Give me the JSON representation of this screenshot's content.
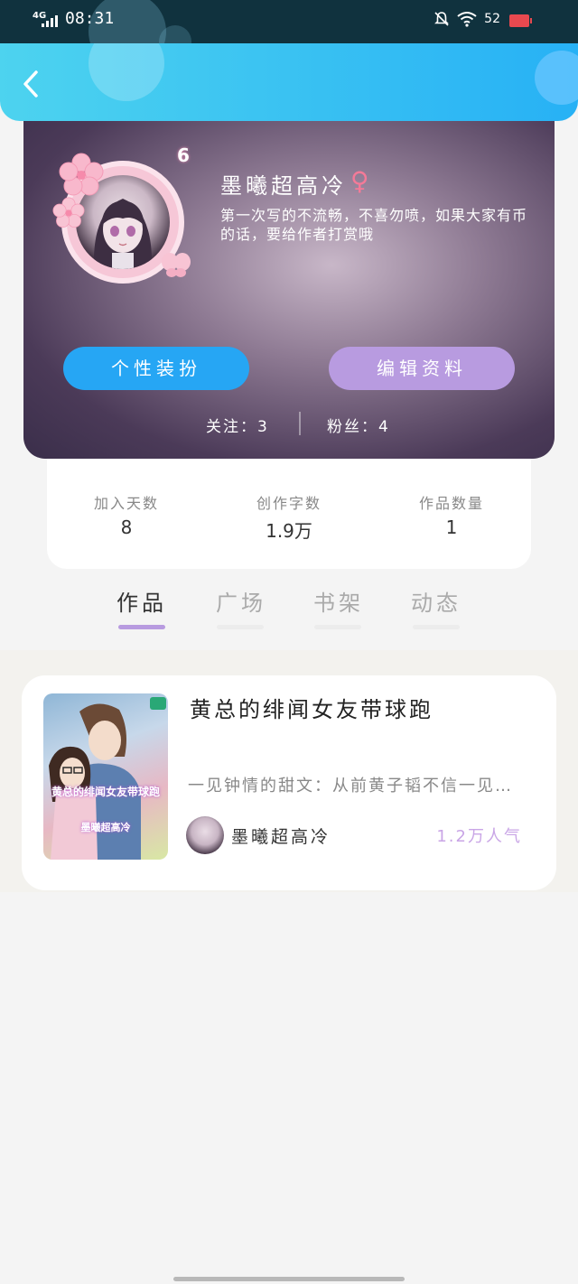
{
  "status_bar": {
    "network": "4G",
    "time": "08:31",
    "battery": "52"
  },
  "header": {
    "back_icon": "chevron-left-icon"
  },
  "profile": {
    "level": "6",
    "username": "墨曦超高冷",
    "gender_symbol": "♀",
    "gender_color": "#f47a98",
    "bio": "第一次写的不流畅，不喜勿喷，如果大家有币的话，要给作者打赏哦",
    "dress_button": "个性装扮",
    "edit_button": "编辑资料",
    "follow_label": "关注：",
    "follow_count": "3",
    "fans_label": "粉丝：",
    "fans_count": "4"
  },
  "stats": [
    {
      "label": "加入天数",
      "value": "8"
    },
    {
      "label": "创作字数",
      "value": "1.9万"
    },
    {
      "label": "作品数量",
      "value": "1"
    }
  ],
  "tabs": [
    {
      "label": "作品",
      "active": true
    },
    {
      "label": "广场",
      "active": false
    },
    {
      "label": "书架",
      "active": false
    },
    {
      "label": "动态",
      "active": false
    }
  ],
  "work": {
    "title": "黄总的绯闻女友带球跑",
    "summary": "一见钟情的甜文：从前黄子韬不信一见…",
    "author": "墨曦超高冷",
    "popularity": "1.2万人气",
    "cover_text": "黄总的绯闻女友带球跑",
    "cover_author": "墨曦超高冷"
  },
  "colors": {
    "header_start": "#4dd3ef",
    "header_end": "#27b1f5",
    "accent_blue": "#26a6f4",
    "accent_purple": "#b89be0",
    "popularity": "#c9a5e6"
  }
}
